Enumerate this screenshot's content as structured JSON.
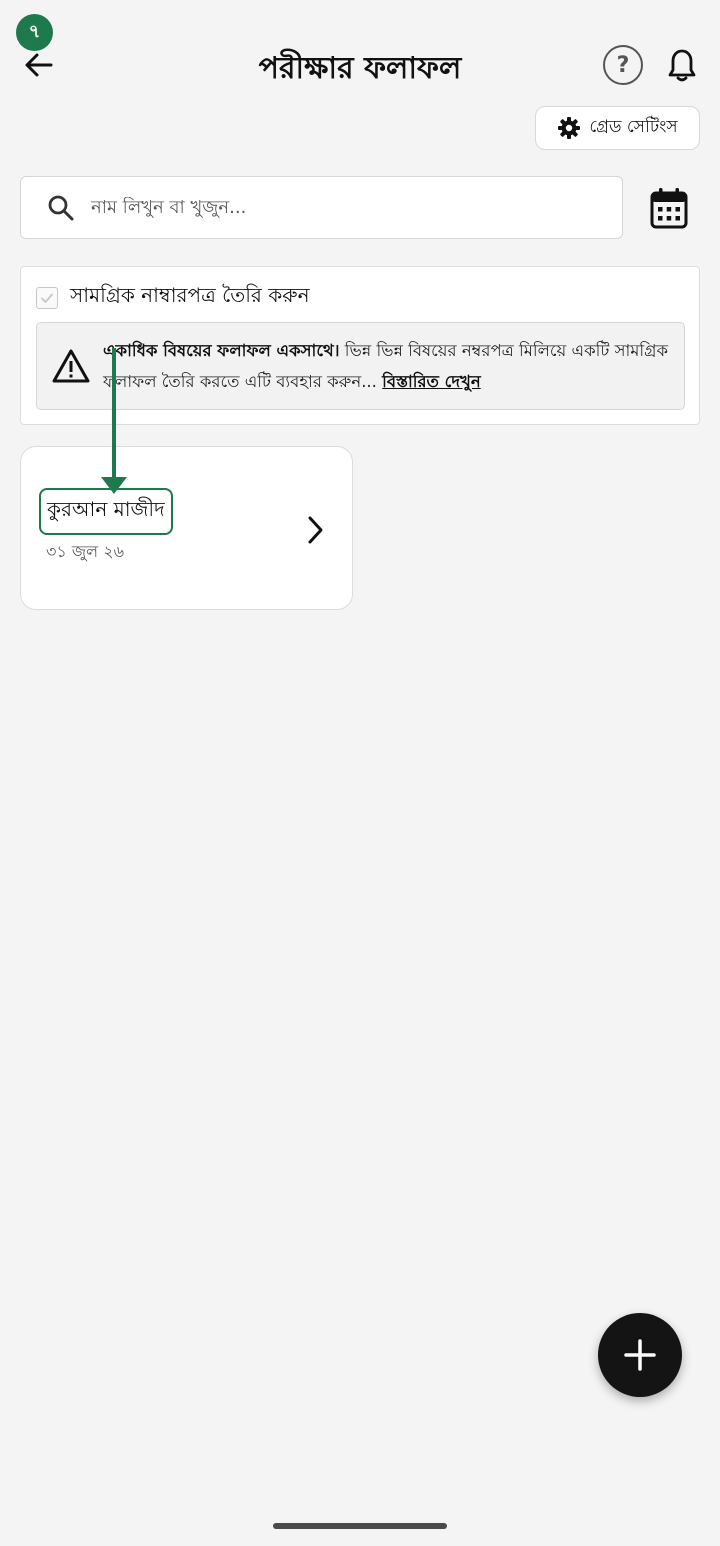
{
  "step_badge": "৭",
  "header": {
    "title": "পরীক্ষার ফলাফল",
    "help_symbol": "?",
    "icons": {
      "back": "arrow-left-icon",
      "help": "question-circle-icon",
      "notifications": "bell-icon"
    }
  },
  "grade_settings": {
    "label": "গ্রেড সেটিংস",
    "icon": "gear-icon"
  },
  "search": {
    "placeholder": "নাম লিখুন বা খুজুন...",
    "value": "",
    "icon": "search-icon"
  },
  "calendar": {
    "icon": "calendar-icon"
  },
  "combined": {
    "checkbox_label": "সামগ্রিক নাম্বারপত্র তৈরি করুন",
    "checked": false,
    "info_bold": "একাধিক বিষয়ের ফলাফল একসাথে।",
    "info_text": " ভিন্ন ভিন্ন বিষয়ের নম্বরপত্র মিলিয়ে একটি সামগ্রিক ফলাফল তৈরি করতে এটি ব্যবহার করুন... ",
    "info_link": "বিস্তারিত দেখুন",
    "icon": "warning-triangle-icon"
  },
  "exams": [
    {
      "title": "কুরআন মাজীদ",
      "date": "৩১ জুল ২৬"
    }
  ],
  "fab": {
    "icon": "plus-icon"
  },
  "colors": {
    "accent": "#1e7a4c",
    "background": "#f4f4f4",
    "fab": "#141414"
  }
}
